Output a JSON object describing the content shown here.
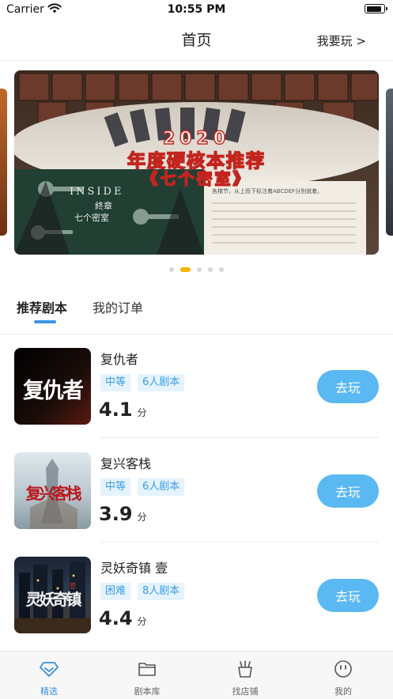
{
  "status_bar": {
    "carrier": "Carrier",
    "time": "10:55 PM",
    "battery_level": 0.9
  },
  "nav": {
    "title": "首页",
    "right_action": "我要玩 >"
  },
  "banner": {
    "year": "2020",
    "headline": "年度硬核本推荐",
    "subtitle": "《七个密室》",
    "side_text": "INSIDE",
    "side_line1": "終章",
    "side_line2": "七个密室",
    "note_line": "各梯节，从上而下标注着ABCDEF分别就着。",
    "page_count": 5,
    "active_page": 1
  },
  "tabs": [
    {
      "label": "推荐剧本",
      "active": true
    },
    {
      "label": "我的订单",
      "active": false
    }
  ],
  "scripts": [
    {
      "title": "复仇者",
      "cover_text": "复仇者",
      "difficulty": "中等",
      "players": "6人剧本",
      "rating": "4.1",
      "rating_unit": "分",
      "button": "去玩"
    },
    {
      "title": "复兴客栈",
      "cover_text": "复兴客栈",
      "difficulty": "中等",
      "players": "6人剧本",
      "rating": "3.9",
      "rating_unit": "分",
      "button": "去玩"
    },
    {
      "title": "灵妖奇镇 壹",
      "cover_text": "灵妖奇镇",
      "cover_mark": "壹",
      "difficulty": "困难",
      "players": "8人剧本",
      "rating": "4.4",
      "rating_unit": "分",
      "button": "去玩"
    }
  ],
  "tabbar": [
    {
      "label": "精选",
      "icon": "diamond-icon",
      "active": true
    },
    {
      "label": "剧本库",
      "icon": "folder-icon",
      "active": false
    },
    {
      "label": "找店铺",
      "icon": "shop-icon",
      "active": false
    },
    {
      "label": "我的",
      "icon": "smiley-icon",
      "active": false
    }
  ],
  "colors": {
    "accent": "#4095e5",
    "button": "#5ab8f2",
    "tag_text": "#3a9ee4",
    "tag_bg": "#e5f3fd",
    "dot_active": "#f5b400"
  }
}
